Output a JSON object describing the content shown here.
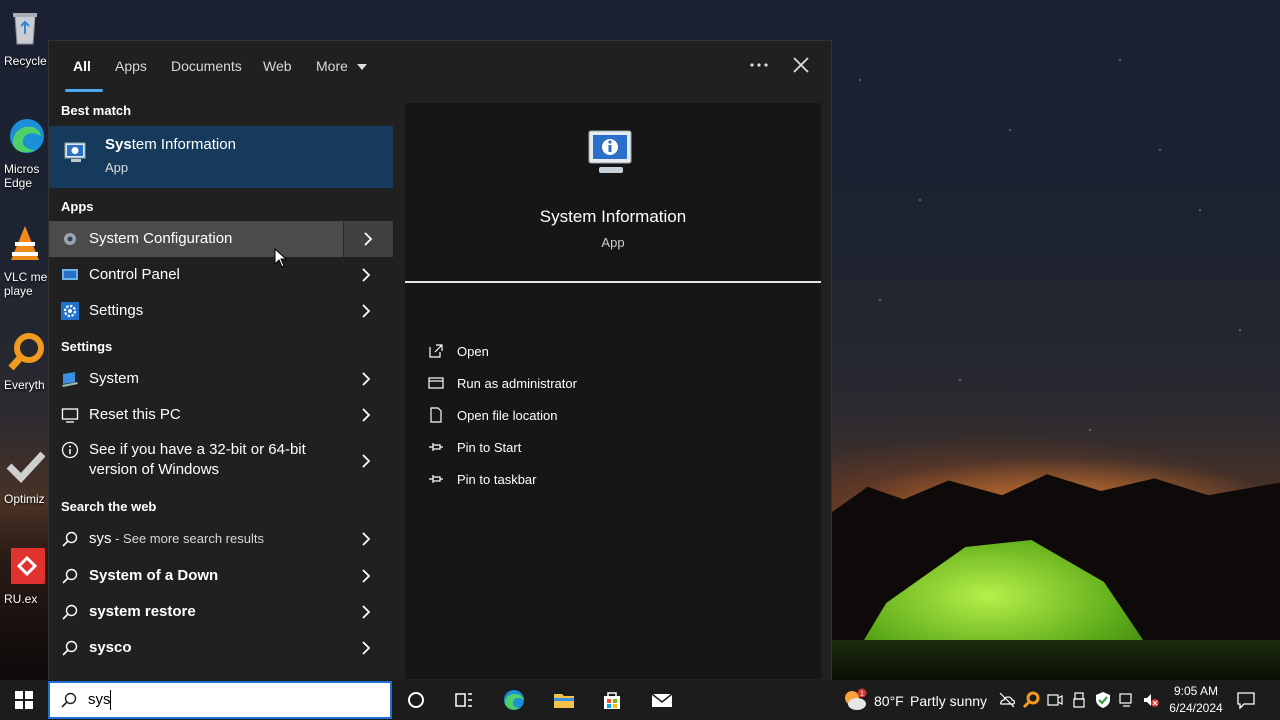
{
  "desktop_icons": [
    {
      "name": "recycle-bin",
      "label": "Recycle"
    },
    {
      "name": "edge",
      "label": "Micros",
      "label2": "Edge"
    },
    {
      "name": "vlc",
      "label": "VLC me",
      "label2": "playe"
    },
    {
      "name": "everything",
      "label": "Everyth"
    },
    {
      "name": "optimize",
      "label": "Optimiz"
    },
    {
      "name": "ru",
      "label": "RU.ex"
    }
  ],
  "tabs": [
    "All",
    "Apps",
    "Documents",
    "Web",
    "More"
  ],
  "sections": {
    "best_match": "Best match",
    "apps": "Apps",
    "settings": "Settings",
    "web": "Search the web"
  },
  "best_match": {
    "title_prefix": "Sys",
    "title_rest": "tem Information",
    "sub": "App"
  },
  "apps": [
    {
      "label": "System Configuration"
    },
    {
      "label": "Control Panel"
    },
    {
      "label": "Settings"
    }
  ],
  "settings_items": [
    {
      "label": "System"
    },
    {
      "label": "Reset this PC"
    },
    {
      "label": "See if you have a 32-bit or 64-bit",
      "label2": "version of Windows"
    }
  ],
  "web_items": [
    {
      "label": "sys",
      "extra": " - See more search results"
    },
    {
      "label": "System of a Down"
    },
    {
      "label": "system restore"
    },
    {
      "label": "sysco"
    }
  ],
  "preview": {
    "title": "System Information",
    "sub": "App"
  },
  "actions": [
    "Open",
    "Run as administrator",
    "Open file location",
    "Pin to Start",
    "Pin to taskbar"
  ],
  "search": {
    "value": "sys"
  },
  "taskbar": {
    "temp": "80°F",
    "weather": "Partly sunny",
    "time": "9:05 AM",
    "date": "6/24/2024",
    "weather_badge": "1"
  },
  "colors": {
    "accent": "#4aa7f0",
    "best_match_bg": "#153a5c",
    "hover": "#4b4b4b"
  }
}
